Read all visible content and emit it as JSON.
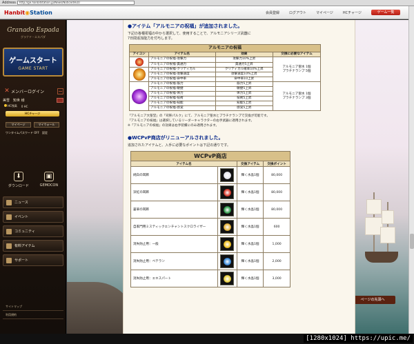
{
  "browser": {
    "address_label": "Address",
    "url": "http://ge.hanbitstation.jp/News/Notice/6920"
  },
  "header": {
    "logo_part1": "Hanbit",
    "logo_part2": "Station",
    "nav": [
      "会員登録",
      "ログアウト",
      "マイページ",
      "HCチャージ"
    ],
    "game_button": "ゲーム一覧"
  },
  "sidebar": {
    "brand_line1": "Granado Espada",
    "brand_line2": "グラナド・エスパダ",
    "gamestart_line1": "ゲームスタート",
    "gamestart_line2": "GAME START",
    "login_label": "メンバーログイン",
    "user_name": "美雪　知世 様",
    "hc_label": "HC残高",
    "hc_value": "0 HC",
    "charge_label": "HCチャージ",
    "mypage_label": "マイページ",
    "mywallet_label": "マイウォール",
    "otp_label": "ワンタイムパスワード OFF　設定",
    "download_label": "ダウンロード",
    "gemocon_label": "GEMOCON",
    "menu": [
      "ニュース",
      "イベント",
      "コミュニティ",
      "有料アイテム",
      "サポート"
    ],
    "bottom_links": [
      "サイトマップ",
      "利用規約"
    ]
  },
  "content": {
    "section1_title": "●アイテム「アルモニアの祝福」が追加されました。",
    "section1_para1": "下記の各種祝福の中から選択して、使用することで、アルモニアシリーズ武器に",
    "section1_para2": "7日間追加能力を付与します。",
    "table1": {
      "caption": "アルモニアの祝福",
      "headers": [
        "アイコン",
        "アイテム名",
        "効果",
        "交換に必要なアイテム"
      ],
      "group1": {
        "rows": [
          [
            "アルモニアの祝福-攻撃力",
            "攻撃力10%上昇"
          ],
          [
            "アルモニアの祝福-貫通力",
            "貫通力5上昇"
          ]
        ],
        "exchange": [
          "アルモニア聖水 1個",
          "プラチナランプ 5個"
        ]
      },
      "group2": {
        "rows": [
          [
            "アルモニアの祝福-クリティカル",
            "クリティカル確率10%上昇"
          ],
          [
            "アルモニアの祝福-攻撃速度",
            "攻撃速度10%上昇"
          ],
          [
            "アルモニアの祝福-命中率",
            "命中率10上昇"
          ]
        ]
      },
      "group3": {
        "rows": [
          [
            "アルモニアの祝福-筋力",
            "筋力5上昇"
          ],
          [
            "アルモニアの祝福-敏捷",
            "敏捷5上昇"
          ],
          [
            "アルモニアの祝福-体力",
            "体力5上昇"
          ],
          [
            "アルモニアの祝福-技術",
            "技術5上昇"
          ],
          [
            "アルモニアの祝福-知能",
            "知能5上昇"
          ],
          [
            "アルモニアの祝福-感覚",
            "感覚5上昇"
          ]
        ],
        "exchange": [
          "アルモニア聖水 1個",
          "プラチナランプ 3個"
        ]
      }
    },
    "section1_note1": "「アルモニア大聖堂」の「司祭パルク」にて、アルモニア聖水とプラチナランプで交換が可能です。",
    "section1_note2": "「アルモニアの祝福」は選択しているリーダーキャラクターの右手武器に適用されます。",
    "section1_note3": "※「アルモニアの祝福」の効果は右手装備にのみ適用されます。",
    "section2_title": "●WCPvP商店がリニューアルされました。",
    "section2_para": "追加されたアイテムと、入手に必要なポイントは下記の通りです。",
    "table2": {
      "caption": "WCPvP商店",
      "headers": [
        "アイテム名",
        "交換アイテム",
        "交換ポイント"
      ],
      "rows": [
        {
          "name": "純白の耳飾",
          "item": "輝く水晶1個",
          "points": "80,000",
          "color": "#e8e8f0"
        },
        {
          "name": "深紅の耳飾",
          "item": "輝く水晶1個",
          "points": "80,000",
          "color": "#d8382a"
        },
        {
          "name": "蒼翠の耳飾",
          "item": "輝く水晶1個",
          "points": "80,000",
          "color": "#2f9a4a"
        },
        {
          "name": "自家門用ミスティックエンチャントスクロライザー",
          "item": "輝く水晶1個",
          "points": "600",
          "color": "#e7b43a"
        },
        {
          "name": "消失防止用：一般",
          "item": "輝く水晶1個",
          "points": "1,000",
          "color": "#f0c020"
        },
        {
          "name": "消失防止用：ベテラン",
          "item": "輝く水晶1個",
          "points": "2,000",
          "color": "#3a8ad8"
        },
        {
          "name": "消失防止用：エキスパート",
          "item": "輝く水晶1個",
          "points": "3,000",
          "color": "#e8d040"
        }
      ]
    }
  },
  "overlay": {
    "back_to_top": "ページの先頭へ",
    "resolution": "[1280x1024]",
    "source_url": "https://upic.me/"
  },
  "colors": {
    "accent_red": "#c00000",
    "title_blue": "#0b2b8c",
    "table_caption": "#d8c089"
  }
}
